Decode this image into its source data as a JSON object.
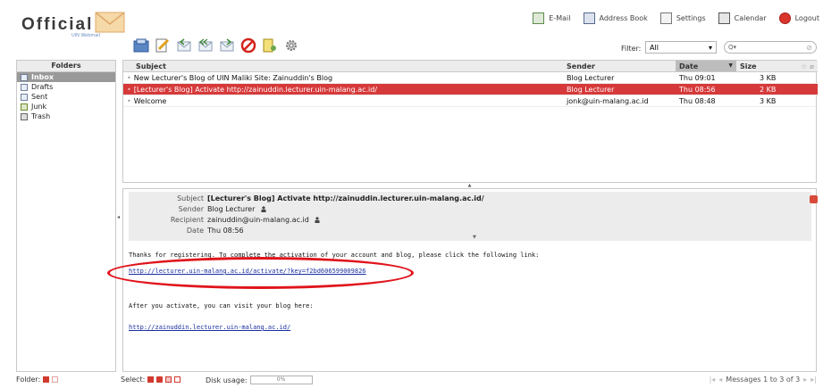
{
  "app": {
    "logo_text": "Official",
    "logo_sub": "UIN Webmail"
  },
  "topnav": [
    {
      "label": "E-Mail",
      "icon": "mail-icon"
    },
    {
      "label": "Address Book",
      "icon": "address-book-icon"
    },
    {
      "label": "Settings",
      "icon": "settings-icon"
    },
    {
      "label": "Calendar",
      "icon": "calendar-icon"
    },
    {
      "label": "Logout",
      "icon": "logout-icon"
    }
  ],
  "toolbar": {
    "buttons": [
      "check-mail",
      "compose",
      "reply",
      "reply-all",
      "forward",
      "delete",
      "mark",
      "more"
    ]
  },
  "filter": {
    "label": "Filter:",
    "value": "All",
    "search_placeholder": "Q▾"
  },
  "folders": {
    "heading": "Folders",
    "items": [
      {
        "label": "Inbox",
        "selected": true
      },
      {
        "label": "Drafts",
        "selected": false
      },
      {
        "label": "Sent",
        "selected": false
      },
      {
        "label": "Junk",
        "selected": false
      },
      {
        "label": "Trash",
        "selected": false
      }
    ]
  },
  "list": {
    "columns": {
      "subject": "Subject",
      "sender": "Sender",
      "date": "Date",
      "size": "Size"
    },
    "rows": [
      {
        "subject": "New Lecturer's Blog of UIN Maliki Site: Zainuddin's Blog",
        "sender": "Blog Lecturer",
        "date": "Thu 09:01",
        "size": "3 KB",
        "selected": false
      },
      {
        "subject": "[Lecturer's Blog] Activate http://zainuddin.lecturer.uin-malang.ac.id/",
        "sender": "Blog Lecturer",
        "date": "Thu 08:56",
        "size": "2 KB",
        "selected": true
      },
      {
        "subject": "Welcome",
        "sender": "jonk@uin-malang.ac.id",
        "date": "Thu 08:48",
        "size": "3 KB",
        "selected": false
      }
    ]
  },
  "preview": {
    "headers": {
      "subject_key": "Subject",
      "subject": "[Lecturer's Blog] Activate http://zainuddin.lecturer.uin-malang.ac.id/",
      "sender_key": "Sender",
      "sender": "Blog Lecturer",
      "recipient_key": "Recipient",
      "recipient": "zainuddin@uin-malang.ac.id",
      "date_key": "Date",
      "date": "Thu 08:56"
    },
    "body": {
      "line1": "Thanks for registering. To complete the activation of your account and blog, please click the following link:",
      "activate_link": "http://lecturer.uin-malang.ac.id/activate/?key=f2bd606599009826",
      "line2": "After you activate, you can visit your blog here:",
      "blog_link": "http://zainuddin.lecturer.uin-malang.ac.id/"
    }
  },
  "footer": {
    "folder_label": "Folder:",
    "select_label": "Select:",
    "disk_label": "Disk usage:",
    "disk_value": "0%",
    "pager_text": "Messages 1 to 3 of 3"
  },
  "colors": {
    "selected_row": "#d6393a",
    "selected_folder": "#999999",
    "highlight_oval": "#e0141b"
  }
}
